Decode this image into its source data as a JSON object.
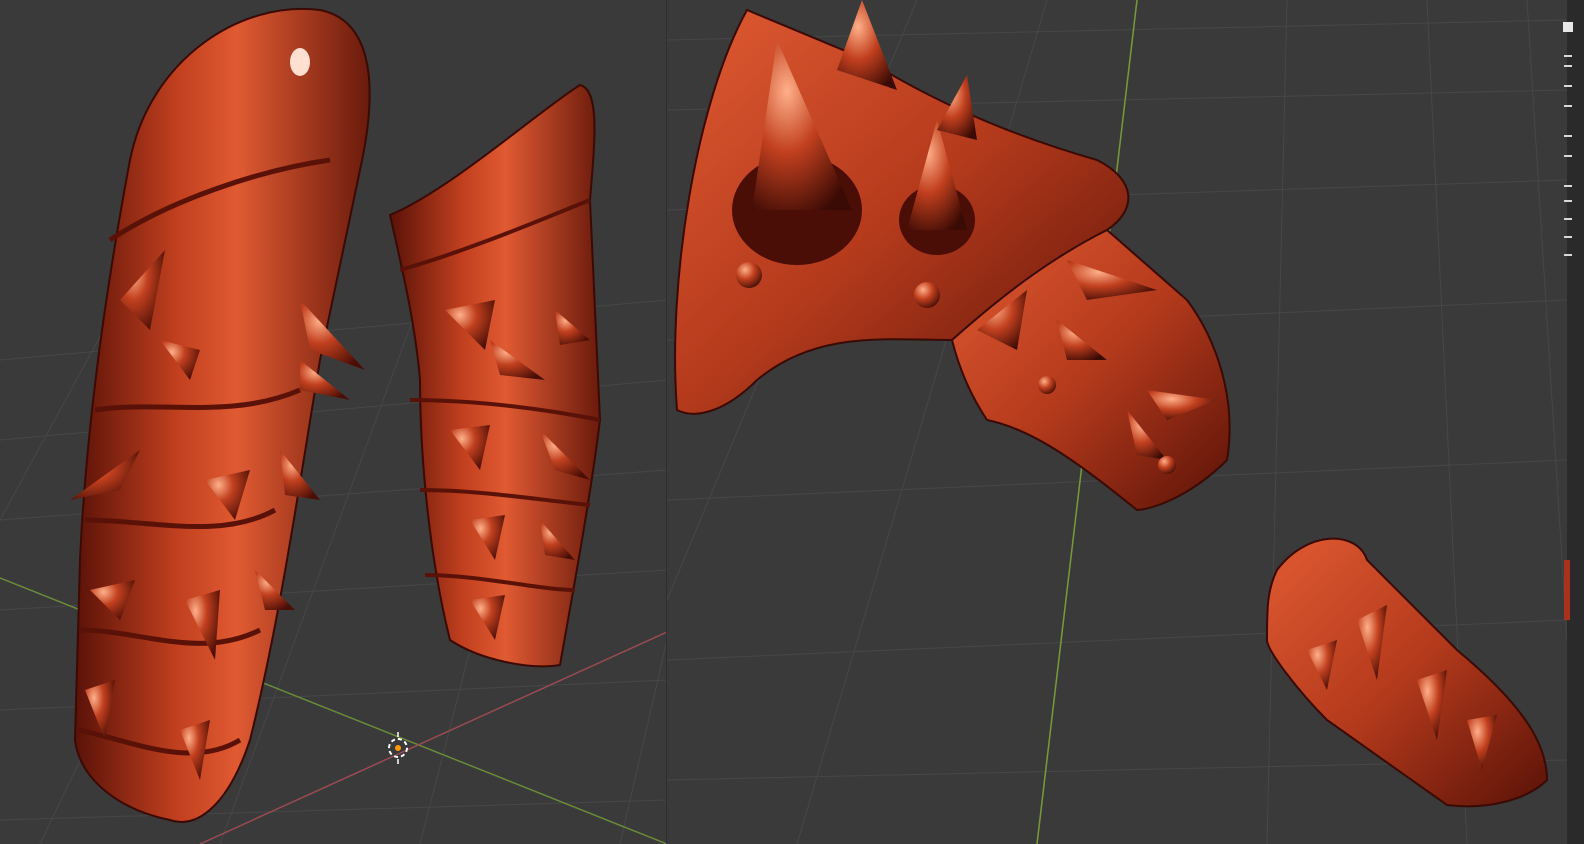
{
  "app": {
    "viewports": [
      {
        "name": "left-3d-viewport",
        "object": "bracer-pair"
      },
      {
        "name": "right-3d-viewport",
        "object": "spiked-gauntlet-and-bracer"
      }
    ],
    "side_panel": {
      "visible_text": ""
    }
  },
  "colors": {
    "viewport_bg": "#3a3a3a",
    "grid_line": "#474747",
    "axis_x": "#a8505a",
    "axis_y": "#7a9a3a",
    "armor_base": "#a8321e",
    "armor_dark": "#4a0e06",
    "armor_highlight": "#ff9b7a",
    "cursor_ring": "#ffffff",
    "cursor_center": "#ff9900"
  },
  "icons": {
    "cursor": "3d-cursor-icon"
  }
}
